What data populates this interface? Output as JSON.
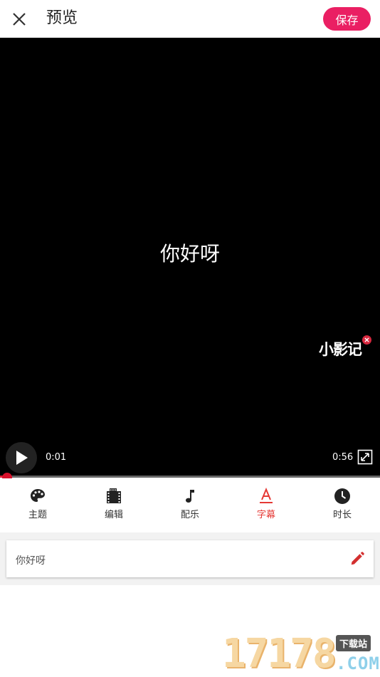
{
  "header": {
    "title": "预览",
    "save_label": "保存"
  },
  "player": {
    "subtitle": "你好呀",
    "watermark": "小影记",
    "current_time": "0:01",
    "total_time": "0:56",
    "progress_fraction": 0.018
  },
  "tabs": [
    {
      "label": "主题",
      "icon": "palette-icon",
      "active": false
    },
    {
      "label": "编辑",
      "icon": "film-icon",
      "active": false
    },
    {
      "label": "配乐",
      "icon": "music-note-icon",
      "active": false
    },
    {
      "label": "字幕",
      "icon": "text-a-icon",
      "active": true
    },
    {
      "label": "时长",
      "icon": "clock-icon",
      "active": false
    }
  ],
  "caption": {
    "value": "你好呀"
  },
  "site_watermark": {
    "number": "17178",
    "badge": "下载站",
    "suffix": ".COM"
  },
  "colors": {
    "accent": "#ea1f63",
    "active_tab": "#e53935",
    "edit_icon": "#d32f2f"
  }
}
